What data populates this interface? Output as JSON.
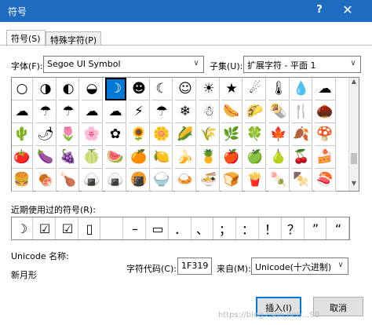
{
  "window": {
    "title": "符号",
    "help_glyph": "?",
    "close_glyph": "✕"
  },
  "tabs": [
    {
      "label": "符号(S)",
      "active": true
    },
    {
      "label": "特殊字符(P)",
      "active": false
    }
  ],
  "font": {
    "label": "字体(F):",
    "value": "Segoe UI Symbol",
    "arrow": "∨"
  },
  "subset": {
    "label": "子集(U):",
    "value": "扩展字符 - 平面 1",
    "arrow": "∨"
  },
  "symbols": [
    [
      "○",
      "◑",
      "◐",
      "◒",
      "☽",
      "☻",
      "☾",
      "☺",
      "☀",
      "★",
      "☄",
      "🌡",
      "💧",
      "☁"
    ],
    [
      "☁",
      "☂",
      "☂",
      "☁",
      "☁",
      "⚡",
      "☂",
      "❄",
      "☃",
      "🌭",
      "🌮",
      "🌯",
      "🍴",
      "🌰"
    ],
    [
      "🌵",
      "🌶",
      "🌷",
      "🌸",
      "✿",
      "🌻",
      "🌼",
      "🌽",
      "🌾",
      "🌿",
      "🍀",
      "🍁",
      "🍂",
      "🍄"
    ],
    [
      "🍅",
      "🍆",
      "🍇",
      "🍈",
      "🍉",
      "🍊",
      "🍋",
      "🍌",
      "🍍",
      "🍎",
      "🍏",
      "🍐",
      "🍒",
      "🍰"
    ],
    [
      "🍔",
      "🍖",
      "🍗",
      "🍙",
      "🍙",
      "🍘",
      "🍚",
      "🍛",
      "🍜",
      "🍞",
      "🍟",
      "🍡",
      "🍢",
      "🍣"
    ]
  ],
  "selected": {
    "row": 0,
    "col": 4
  },
  "recent": {
    "label": "近期使用过的符号(R):",
    "items": [
      "☽",
      "☑",
      "☑",
      "▯",
      "",
      "–",
      "▭",
      "．",
      "、",
      "；",
      "：",
      "！",
      "？",
      "”",
      "“"
    ]
  },
  "unicode_name": {
    "label": "Unicode 名称:",
    "value": "新月形"
  },
  "char_code": {
    "label": "字符代码(C):",
    "value": "1F319"
  },
  "from": {
    "label": "来自(M):",
    "value": "Unicode(十六进制)",
    "arrow": "∨"
  },
  "buttons": {
    "insert": "插入(I)",
    "cancel": "取消"
  },
  "watermark": "https://blog.csdn.net/...90"
}
